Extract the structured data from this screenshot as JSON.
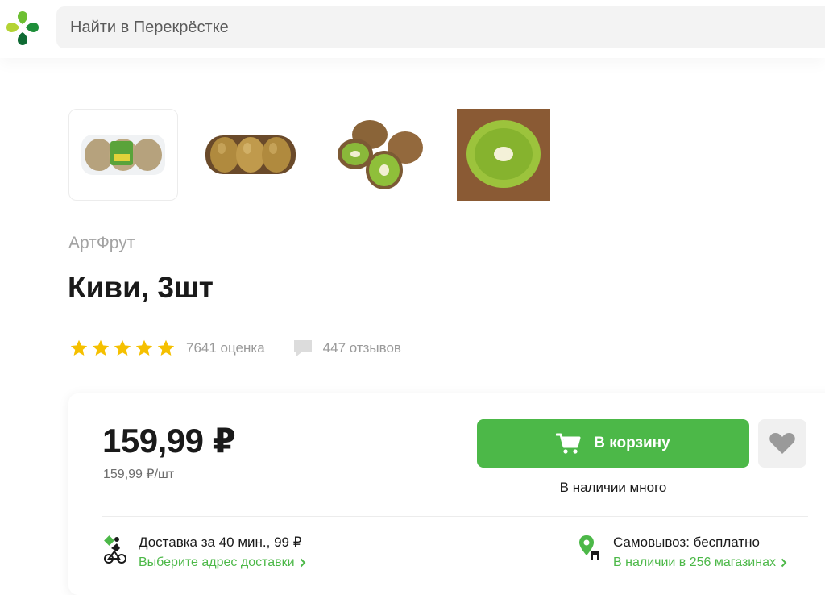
{
  "header": {
    "search_placeholder": "Найти в Перекрёстке"
  },
  "gallery": {
    "images": [
      "kiwi-packaged-image",
      "kiwi-tray-image",
      "kiwi-halves-image",
      "kiwi-slice-image"
    ]
  },
  "product": {
    "brand": "АртФрут",
    "title": "Киви, 3шт",
    "rating_count": "7641 оценка",
    "reviews_count": "447 отзывов",
    "stars": 5
  },
  "purchase": {
    "price": "159,99 ₽",
    "unit_price": "159,99 ₽/шт",
    "cart_label": "В корзину",
    "stock": "В наличии много"
  },
  "delivery": {
    "title": "Доставка за 40 мин., 99 ₽",
    "link": "Выберите адрес доставки"
  },
  "pickup": {
    "title": "Самовывоз: бесплатно",
    "link": "В наличии в 256 магазинах"
  },
  "colors": {
    "accent": "#4cb848",
    "star": "#f5c000"
  }
}
